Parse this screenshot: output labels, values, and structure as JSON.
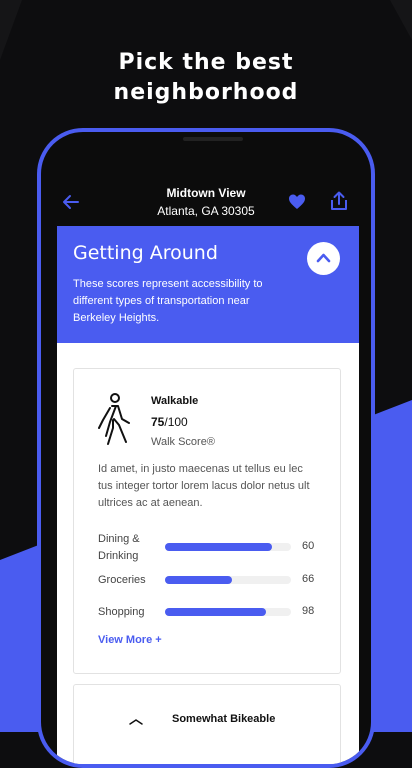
{
  "headline": {
    "line1": "Pick the best",
    "line2": "neighborhood"
  },
  "colors": {
    "accent": "#4a5cf0",
    "background": "#0d0d0f"
  },
  "topbar": {
    "title": "Midtown View",
    "subtitle": "Atlanta, GA 30305",
    "back_icon": "arrow-left-icon",
    "favorite_icon": "heart-icon",
    "share_icon": "share-icon"
  },
  "section": {
    "title": "Getting Around",
    "description": "These scores represent accessibility to different types of transportation near Berkeley Heights.",
    "collapse_icon": "chevron-up-icon"
  },
  "walk_card": {
    "icon": "walking-person-icon",
    "title": "Walkable",
    "score": "75",
    "score_max": "/100",
    "source": "Walk Score®",
    "body": "Id amet, in justo maecenas ut tellus eu lec tus integer tortor lorem lacus dolor netus ult ultrices ac at aenean.",
    "metrics": [
      {
        "label": "Dining & Drinking",
        "value": "60",
        "fill": 0.85
      },
      {
        "label": "Groceries",
        "value": "66",
        "fill": 0.53
      },
      {
        "label": "Shopping",
        "value": "98",
        "fill": 0.8
      }
    ],
    "view_more": "View More +"
  },
  "bike_card": {
    "title": "Somewhat Bikeable"
  }
}
